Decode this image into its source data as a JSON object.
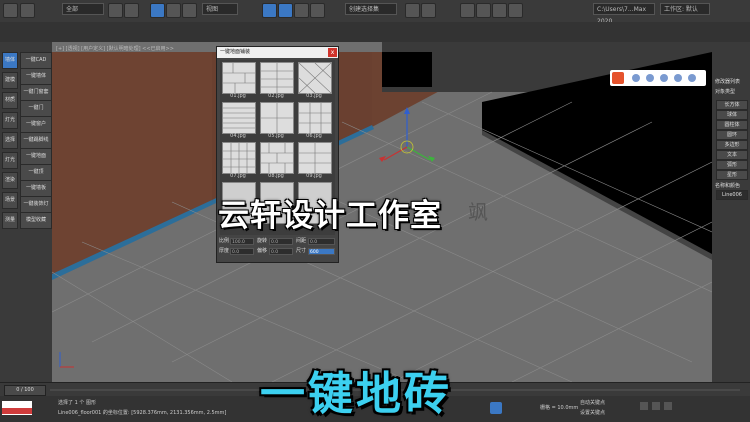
{
  "toolbar": {
    "scope_select": "全部",
    "view_select": "视图",
    "selection_set": "创建选择集",
    "path_field": "C:\\Users\\7...Max 2020",
    "workspace": "工作区: 默认"
  },
  "viewport": {
    "label": "[+] [透视] [用户定义] [默认明暗处理] <<已启用>>"
  },
  "left_panel": {
    "tabs": [
      "墙体",
      "建模",
      "材质",
      "灯光",
      "选择",
      "灯光",
      "渲染",
      "场景",
      "测量"
    ],
    "buttons": [
      "一键CAD",
      "一键墙体",
      "一键门窗套",
      "一键门",
      "一键窗户",
      "一键踢脚线",
      "一键地面",
      "一键顶",
      "一键墙板",
      "一键装饰灯",
      "模型收藏"
    ]
  },
  "right_panel": {
    "header": "修改器列表",
    "section": "对象类型",
    "buttons": [
      "长方体",
      "球体",
      "圆柱体",
      "圆环",
      "多边形",
      "文本",
      "弧形",
      "星形"
    ],
    "name_section": "名称和颜色",
    "name_value": "Line006"
  },
  "dialog": {
    "title": "一键地面铺装",
    "close": "x",
    "tiles": [
      "01.jpg",
      "02.jpg",
      "03.jpg",
      "04.jpg",
      "05.jpg",
      "06.jpg",
      "07.jpg",
      "08.jpg",
      "09.jpg"
    ],
    "row1": {
      "ratio_label": "比例",
      "ratio_value": "100.0",
      "rotate_label": "旋转",
      "rotate_value": "0.0",
      "gap_label": "间距",
      "gap_value": "0.0"
    },
    "row2": {
      "thickness_label": "厚度",
      "thickness_value": "0.0",
      "offset_label": "偏移",
      "offset_value": "0.0",
      "size_label": "尺寸",
      "size_value": "600"
    }
  },
  "timeline": {
    "frame": "0 / 100"
  },
  "status": {
    "selected": "选择了 1 个 图形",
    "object": "Line006_floor001 的坐标位置: [5928.376mm, 2131.356mm, 2.5mm]",
    "grid": "栅格 = 10.0mm",
    "autokey": "自动关键点",
    "setkey": "设置关键点"
  },
  "overlay": {
    "watermark": "云轩设计工作室",
    "ghost": "飒",
    "caption": "一键地砖"
  },
  "colors": {
    "accent": "#3b78c4",
    "caption": "#3cd0f0",
    "floor": "#6f6f6f",
    "brick": "#6e4332"
  }
}
